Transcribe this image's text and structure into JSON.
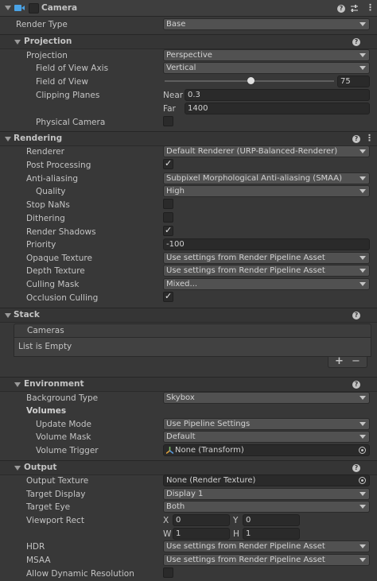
{
  "component": {
    "title": "Camera",
    "enabled": false,
    "icons": [
      "camera-icon",
      "help-icon",
      "preset-icon",
      "menu-icon"
    ]
  },
  "render_type": {
    "label": "Render Type",
    "value": "Base"
  },
  "projection": {
    "title": "Projection",
    "projection": {
      "label": "Projection",
      "value": "Perspective"
    },
    "fov_axis": {
      "label": "Field of View Axis",
      "value": "Vertical"
    },
    "fov": {
      "label": "Field of View",
      "value": "75",
      "fraction": 0.51
    },
    "clipping": {
      "label": "Clipping Planes",
      "near_label": "Near",
      "near": "0.3",
      "far_label": "Far",
      "far": "1400"
    },
    "physical": {
      "label": "Physical Camera",
      "checked": false
    }
  },
  "rendering": {
    "title": "Rendering",
    "renderer": {
      "label": "Renderer",
      "value": "Default Renderer (URP-Balanced-Renderer)"
    },
    "post": {
      "label": "Post Processing",
      "checked": true
    },
    "aa": {
      "label": "Anti-aliasing",
      "value": "Subpixel Morphological Anti-aliasing (SMAA)"
    },
    "quality": {
      "label": "Quality",
      "value": "High"
    },
    "stop_nans": {
      "label": "Stop NaNs",
      "checked": false
    },
    "dithering": {
      "label": "Dithering",
      "checked": false
    },
    "shadows": {
      "label": "Render Shadows",
      "checked": true
    },
    "priority": {
      "label": "Priority",
      "value": "-100"
    },
    "opaque": {
      "label": "Opaque Texture",
      "value": "Use settings from Render Pipeline Asset"
    },
    "depth": {
      "label": "Depth Texture",
      "value": "Use settings from Render Pipeline Asset"
    },
    "mask": {
      "label": "Culling Mask",
      "value": "Mixed..."
    },
    "occlusion": {
      "label": "Occlusion Culling",
      "checked": true
    }
  },
  "stack": {
    "title": "Stack",
    "list_header": "Cameras",
    "empty_text": "List is Empty",
    "add": "+",
    "remove": "−"
  },
  "environment": {
    "title": "Environment",
    "bg_type": {
      "label": "Background Type",
      "value": "Skybox"
    },
    "volumes_label": "Volumes",
    "update_mode": {
      "label": "Update Mode",
      "value": "Use Pipeline Settings"
    },
    "volume_mask": {
      "label": "Volume Mask",
      "value": "Default"
    },
    "volume_trigger": {
      "label": "Volume Trigger",
      "value": "None (Transform)"
    }
  },
  "output": {
    "title": "Output",
    "texture": {
      "label": "Output Texture",
      "value": "None (Render Texture)"
    },
    "display": {
      "label": "Target Display",
      "value": "Display 1"
    },
    "eye": {
      "label": "Target Eye",
      "value": "Both"
    },
    "viewport": {
      "label": "Viewport Rect",
      "x_label": "X",
      "x": "0",
      "y_label": "Y",
      "y": "0",
      "w_label": "W",
      "w": "1",
      "h_label": "H",
      "h": "1"
    },
    "hdr": {
      "label": "HDR",
      "value": "Use settings from Render Pipeline Asset"
    },
    "msaa": {
      "label": "MSAA",
      "value": "Use settings from Render Pipeline Asset"
    },
    "dynamic": {
      "label": "Allow Dynamic Resolution",
      "checked": false
    }
  },
  "colors": {
    "background": "#383838",
    "field": "#2a2a2a",
    "dropdown": "#515151",
    "camera_icon": "#4aa3e6"
  }
}
